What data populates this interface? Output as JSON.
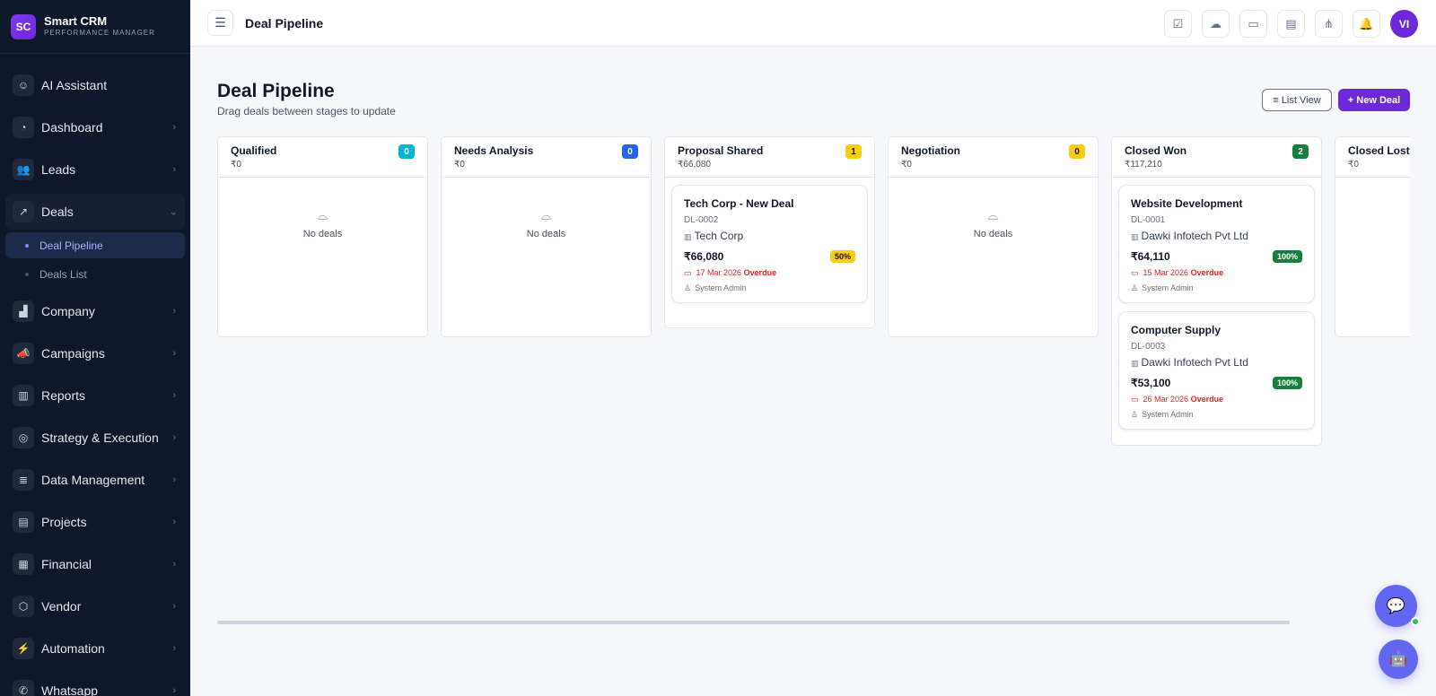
{
  "brand": {
    "initials": "SC",
    "name": "Smart CRM",
    "subtitle": "PERFORMANCE MANAGER"
  },
  "sidebar": {
    "items": [
      {
        "label": "AI Assistant",
        "icon": "robot-icon",
        "glyph": "☺"
      },
      {
        "label": "Dashboard",
        "icon": "gauge-icon",
        "glyph": "◔"
      },
      {
        "label": "Leads",
        "icon": "users-icon",
        "glyph": "👥"
      },
      {
        "label": "Deals",
        "icon": "trend-icon",
        "glyph": "↗"
      },
      {
        "label": "Company",
        "icon": "building-icon",
        "glyph": "▟"
      },
      {
        "label": "Campaigns",
        "icon": "megaphone-icon",
        "glyph": "📣"
      },
      {
        "label": "Reports",
        "icon": "bar-chart-icon",
        "glyph": "▥"
      },
      {
        "label": "Strategy & Execution",
        "icon": "target-icon",
        "glyph": "◎"
      },
      {
        "label": "Data Management",
        "icon": "database-icon",
        "glyph": "≣"
      },
      {
        "label": "Projects",
        "icon": "kanban-icon",
        "glyph": "▤"
      },
      {
        "label": "Financial",
        "icon": "receipt-icon",
        "glyph": "▦"
      },
      {
        "label": "Vendor",
        "icon": "box-icon",
        "glyph": "⬡"
      },
      {
        "label": "Automation",
        "icon": "bolt-icon",
        "glyph": "⚡"
      },
      {
        "label": "Whatsapp",
        "icon": "whatsapp-icon",
        "glyph": "✆"
      }
    ],
    "deals_sub": [
      {
        "label": "Deal Pipeline",
        "active": true
      },
      {
        "label": "Deals List",
        "active": false
      }
    ]
  },
  "header": {
    "title": "Deal Pipeline",
    "avatar": "VI"
  },
  "main": {
    "title": "Deal Pipeline",
    "subtitle": "Drag deals between stages to update",
    "list_view_label": "≡ List View",
    "new_deal_label": "+ New Deal"
  },
  "stages": [
    {
      "name": "Qualified",
      "amount": "₹0",
      "count": "0",
      "color": "#06b6d4",
      "deals": []
    },
    {
      "name": "Needs Analysis",
      "amount": "₹0",
      "count": "0",
      "color": "#2563eb",
      "deals": []
    },
    {
      "name": "Proposal Shared",
      "amount": "₹66,080",
      "count": "1",
      "color": "#facc15",
      "deals": [
        {
          "title": "Tech Corp - New Deal",
          "id": "DL-0002",
          "company": "Tech Corp",
          "value": "₹66,080",
          "probability": "50%",
          "prob_bg": "#facc15",
          "prob_fg": "#111827",
          "date": "17 Mar 2026",
          "status": "Overdue",
          "owner": "System Admin"
        }
      ]
    },
    {
      "name": "Negotiation",
      "amount": "₹0",
      "count": "0",
      "color": "#facc15",
      "deals": []
    },
    {
      "name": "Closed Won",
      "amount": "₹117,210",
      "count": "2",
      "color": "#15803d",
      "deals": [
        {
          "title": "Website Development",
          "id": "DL-0001",
          "company": "Dawki Infotech Pvt Ltd",
          "value": "₹64,110",
          "probability": "100%",
          "prob_bg": "#15803d",
          "prob_fg": "#ffffff",
          "date": "15 Mar 2026",
          "status": "Overdue",
          "owner": "System Admin"
        },
        {
          "title": "Computer Supply",
          "id": "DL-0003",
          "company": "Dawki Infotech Pvt Ltd",
          "value": "₹53,100",
          "probability": "100%",
          "prob_bg": "#15803d",
          "prob_fg": "#ffffff",
          "date": "26 Mar 2026",
          "status": "Overdue",
          "owner": "System Admin"
        }
      ]
    },
    {
      "name": "Closed Lost",
      "amount": "₹0",
      "count": "",
      "color": "#dc2626",
      "deals": []
    }
  ],
  "empty_text": "No deals"
}
